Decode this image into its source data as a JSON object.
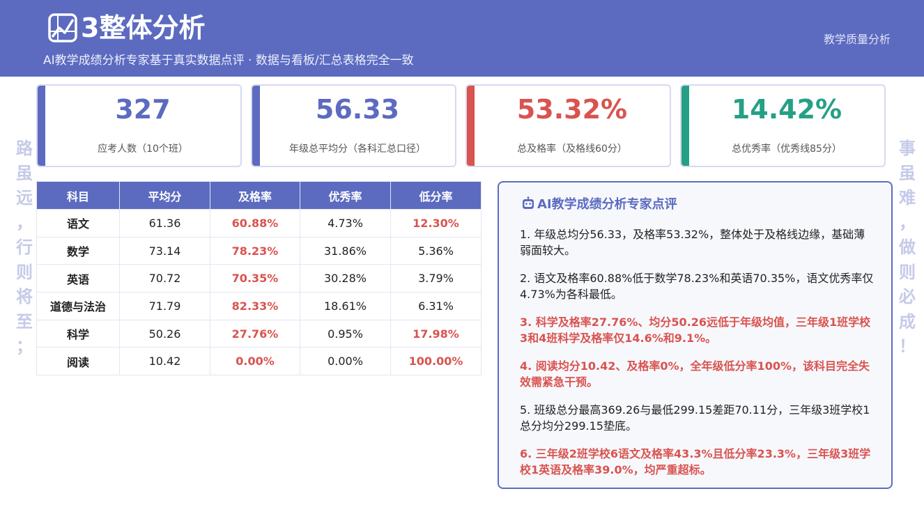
{
  "header": {
    "title": "3整体分析",
    "subtitle": "AI教学成绩分析专家基于真实数据点评 · 数据与看板/汇总表格完全一致",
    "top_right": "教学质量分析",
    "background_color": "#5c6bc0"
  },
  "side_left": [
    "路",
    "虽",
    "远",
    "，",
    "行",
    "则",
    "将",
    "至",
    "；"
  ],
  "side_right": [
    "事",
    "虽",
    "难",
    "，",
    "做",
    "则",
    "必",
    "成",
    "！"
  ],
  "kpis": [
    {
      "value": "327",
      "label": "应考人数（10个班）",
      "color": "#5c6bc0"
    },
    {
      "value": "56.33",
      "label": "年级总平均分（各科汇总口径）",
      "color": "#5c6bc0"
    },
    {
      "value": "53.32%",
      "label": "总及格率（及格线60分）",
      "color": "#d9534f"
    },
    {
      "value": "14.42%",
      "label": "总优秀率（优秀线85分）",
      "color": "#26a085"
    }
  ],
  "table": {
    "headers": [
      "科目",
      "平均分",
      "及格率",
      "优秀率",
      "低分率"
    ],
    "rows": [
      {
        "subject": "语文",
        "avg": "61.36",
        "pass": "60.88%",
        "excellent": "4.73%",
        "low": "12.30%",
        "pass_hl": true,
        "low_hl": true
      },
      {
        "subject": "数学",
        "avg": "73.14",
        "pass": "78.23%",
        "excellent": "31.86%",
        "low": "5.36%",
        "pass_hl": true,
        "low_hl": false
      },
      {
        "subject": "英语",
        "avg": "70.72",
        "pass": "70.35%",
        "excellent": "30.28%",
        "low": "3.79%",
        "pass_hl": true,
        "low_hl": false
      },
      {
        "subject": "道德与法治",
        "avg": "71.79",
        "pass": "82.33%",
        "excellent": "18.61%",
        "low": "6.31%",
        "pass_hl": true,
        "low_hl": false
      },
      {
        "subject": "科学",
        "avg": "50.26",
        "pass": "27.76%",
        "excellent": "0.95%",
        "low": "17.98%",
        "pass_hl": true,
        "low_hl": true
      },
      {
        "subject": "阅读",
        "avg": "10.42",
        "pass": "0.00%",
        "excellent": "0.00%",
        "low": "100.00%",
        "pass_hl": true,
        "low_hl": true
      }
    ]
  },
  "review": {
    "title": "AI教学成绩分析专家点评",
    "icon": "robot-icon",
    "items": [
      {
        "text": "1. 年级总均分56.33，及格率53.32%，整体处于及格线边缘，基础薄弱面较大。",
        "warn": false
      },
      {
        "text": "2. 语文及格率60.88%低于数学78.23%和英语70.35%，语文优秀率仅4.73%为各科最低。",
        "warn": false
      },
      {
        "text": "3. 科学及格率27.76%、均分50.26远低于年级均值，三年级1班学校3和4班科学及格率仅14.6%和9.1%。",
        "warn": true
      },
      {
        "text": "4. 阅读均分10.42、及格率0%，全年级低分率100%，该科目完全失效需紧急干预。",
        "warn": true
      },
      {
        "text": "5. 班级总分最高369.26与最低299.15差距70.11分，三年级3班学校1总分均分299.15垫底。",
        "warn": false
      },
      {
        "text": "6. 三年级2班学校6语文及格率43.3%且低分率23.3%，三年级3班学校1英语及格率39.0%，均严重超标。",
        "warn": true
      }
    ]
  }
}
